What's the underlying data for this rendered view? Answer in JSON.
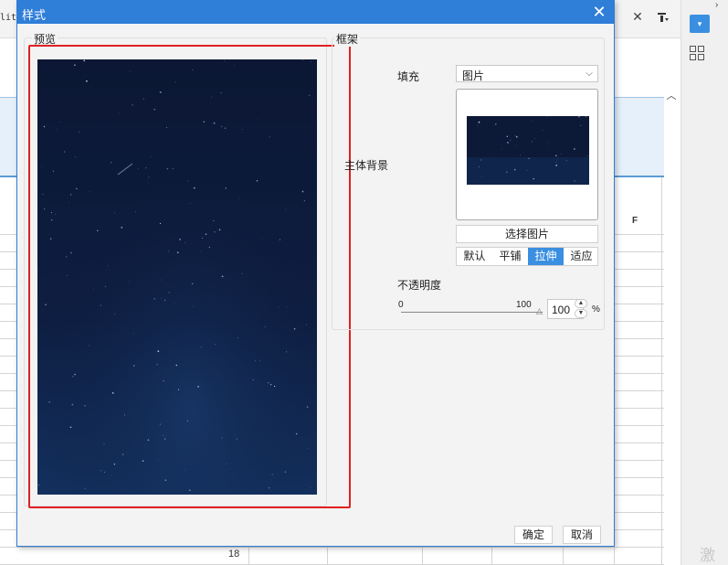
{
  "background": {
    "left_clipped_text": "lity",
    "tab_fragment": "t",
    "close_icon": "close-icon",
    "column_header": "F",
    "row_number": "18",
    "watermark": "激活",
    "scroll_up_icon": "chevron-up-icon"
  },
  "dialog": {
    "title": "样式",
    "close_glyph": "✕",
    "accent_color": "#2f7ed8",
    "highlight_color": "#e02020"
  },
  "preview": {
    "legend": "预览"
  },
  "frame": {
    "legend": "框架",
    "fill_label": "填充",
    "fill_value": "图片",
    "body_bg_label": "主体背景",
    "choose_image_label": "选择图片",
    "modes": [
      "默认",
      "平铺",
      "拉伸",
      "适应"
    ],
    "active_mode": "拉伸",
    "opacity_label": "不透明度",
    "opacity_min": "0",
    "opacity_max": "100",
    "opacity_value": "100",
    "opacity_fraction": 1.0,
    "percent": "%"
  },
  "footer": {
    "ok_label": "确定",
    "cancel_label": "取消"
  }
}
